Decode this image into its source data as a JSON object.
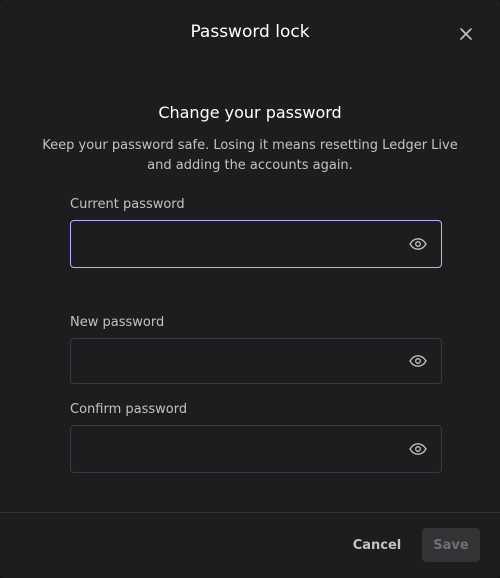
{
  "modal": {
    "title": "Password lock",
    "close_icon": "close-icon"
  },
  "form": {
    "heading": "Change your password",
    "description": "Keep your password safe. Losing it means resetting Ledger Live and adding the accounts again.",
    "fields": [
      {
        "label": "Current password",
        "value": "",
        "focused": true,
        "icon": "eye-icon"
      },
      {
        "label": "New password",
        "value": "",
        "focused": false,
        "icon": "eye-icon"
      },
      {
        "label": "Confirm password",
        "value": "",
        "focused": false,
        "icon": "eye-icon"
      }
    ]
  },
  "footer": {
    "cancel_label": "Cancel",
    "save_label": "Save",
    "save_enabled": false
  },
  "colors": {
    "modal_bg": "#1c1d1f",
    "focus_border": "#bbb0ff",
    "field_border": "#3a3b3e",
    "text_primary": "#ffffff",
    "text_secondary": "#c3c3c6",
    "disabled_button_bg": "#323335"
  }
}
